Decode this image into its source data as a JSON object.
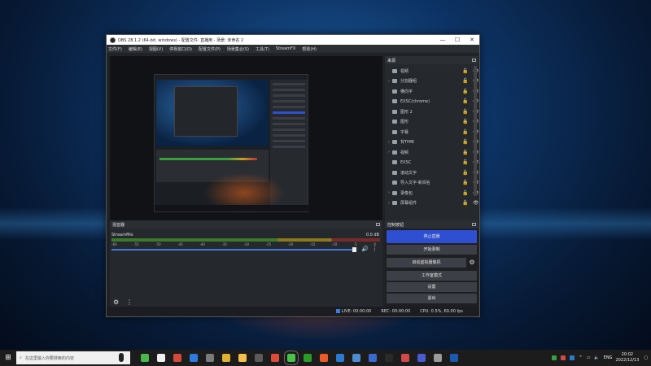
{
  "window": {
    "title": "OBS 28.1.2 (64-bit, windows) - 配置文件: 直播用 - 场景: 未命名 2",
    "minimize": "—",
    "maximize": "☐",
    "close": "✕"
  },
  "menu": [
    "文件(F)",
    "编辑(E)",
    "视图(V)",
    "停靠窗口(D)",
    "配置文件(P)",
    "场景集合(S)",
    "工具(T)",
    "StreamFX",
    "帮助(H)"
  ],
  "sources": {
    "title": "来源",
    "items": [
      {
        "name": "视频",
        "expand": false
      },
      {
        "name": "分割器组",
        "expand": true
      },
      {
        "name": "横向字",
        "expand": false
      },
      {
        "name": "EXSC(chrome)",
        "expand": false
      },
      {
        "name": "图形 2",
        "expand": false
      },
      {
        "name": "图形",
        "expand": false
      },
      {
        "name": "字幕",
        "expand": false
      },
      {
        "name": "背TIME",
        "expand": true
      },
      {
        "name": "视频",
        "expand": true
      },
      {
        "name": "EXSC",
        "expand": false
      },
      {
        "name": "滚动文字",
        "expand": false
      },
      {
        "name": "导入文字-新闻名",
        "expand": false
      },
      {
        "name": "录像包",
        "expand": true
      },
      {
        "name": "屏幕组件",
        "expand": true
      }
    ],
    "tools": [
      "+",
      "🗑",
      "⚙",
      "⌃",
      "⌄"
    ]
  },
  "mixer": {
    "title": "混音器",
    "track": "StreamMix",
    "level": "0.0 dB",
    "ticks": [
      "-60",
      "-55",
      "-50",
      "-45",
      "-40",
      "-35",
      "-30",
      "-25",
      "-20",
      "-15",
      "-10",
      "-5",
      "0"
    ],
    "volume_fraction": 1.0
  },
  "controls": {
    "title": "控制按钮",
    "stop_stream": "停止直播",
    "start_record": "开始录制",
    "start_vcam": "启动虚拟摄像机",
    "studio_mode": "工作室模式",
    "settings": "设置",
    "exit": "退出"
  },
  "status": {
    "live": "LIVE: 00:00:00",
    "rec": "REC: 00:00:00",
    "cpu": "CPU: 0.5%, 60.00 fps"
  },
  "taskbar": {
    "search_placeholder": "在这里输入你要搜索的内容",
    "lang": "ENG",
    "time": "20:02",
    "date": "2022/12/13",
    "app_colors": [
      "#4bb84b",
      "#eeeeee",
      "#d24a3a",
      "#2d7be0",
      "#7a7a7a",
      "#e0b030",
      "#f5c04a",
      "#5a5a5a",
      "#dd4a3a",
      "#4bc04b",
      "#2a9a2a",
      "#ea5a2a",
      "#2a7ad0",
      "#4b8bd0",
      "#3a6ad0",
      "#2a2a2a",
      "#d04a4a",
      "#4b5ad0",
      "#9a9a9a",
      "#1a5ab0"
    ]
  }
}
